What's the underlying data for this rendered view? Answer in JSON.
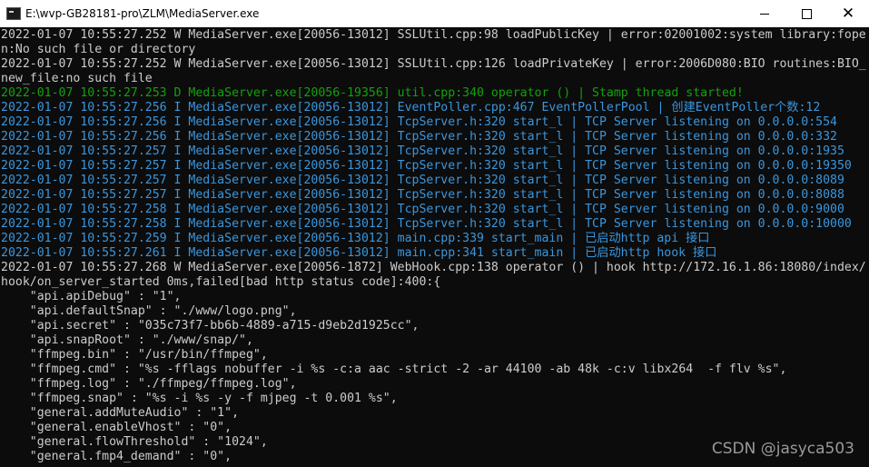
{
  "window": {
    "title": "E:\\wvp-GB28181-pro\\ZLM\\MediaServer.exe",
    "minimize_symbol": "",
    "close_symbol": "✕"
  },
  "console": {
    "lines": [
      {
        "text": "2022-01-07 10:55:27.252 W MediaServer.exe[20056-13012] SSLUtil.cpp:98 loadPublicKey | error:02001002:system library:fope",
        "color": "#cccccc"
      },
      {
        "text": "n:No such file or directory",
        "color": "#cccccc"
      },
      {
        "text": "2022-01-07 10:55:27.252 W MediaServer.exe[20056-13012] SSLUtil.cpp:126 loadPrivateKey | error:2006D080:BIO routines:BIO_",
        "color": "#cccccc"
      },
      {
        "text": "new_file:no such file",
        "color": "#cccccc"
      },
      {
        "text": "2022-01-07 10:55:27.253 D MediaServer.exe[20056-19356] util.cpp:340 operator () | Stamp thread started!",
        "color": "#13a10e"
      },
      {
        "text": "2022-01-07 10:55:27.256 I MediaServer.exe[20056-13012] EventPoller.cpp:467 EventPollerPool | 创建EventPoller个数:12",
        "color": "#3a96dd"
      },
      {
        "text": "2022-01-07 10:55:27.256 I MediaServer.exe[20056-13012] TcpServer.h:320 start_l | TCP Server listening on 0.0.0.0:554",
        "color": "#3a96dd"
      },
      {
        "text": "2022-01-07 10:55:27.256 I MediaServer.exe[20056-13012] TcpServer.h:320 start_l | TCP Server listening on 0.0.0.0:332",
        "color": "#3a96dd"
      },
      {
        "text": "2022-01-07 10:55:27.257 I MediaServer.exe[20056-13012] TcpServer.h:320 start_l | TCP Server listening on 0.0.0.0:1935",
        "color": "#3a96dd"
      },
      {
        "text": "2022-01-07 10:55:27.257 I MediaServer.exe[20056-13012] TcpServer.h:320 start_l | TCP Server listening on 0.0.0.0:19350",
        "color": "#3a96dd"
      },
      {
        "text": "2022-01-07 10:55:27.257 I MediaServer.exe[20056-13012] TcpServer.h:320 start_l | TCP Server listening on 0.0.0.0:8089",
        "color": "#3a96dd"
      },
      {
        "text": "2022-01-07 10:55:27.257 I MediaServer.exe[20056-13012] TcpServer.h:320 start_l | TCP Server listening on 0.0.0.0:8088",
        "color": "#3a96dd"
      },
      {
        "text": "2022-01-07 10:55:27.258 I MediaServer.exe[20056-13012] TcpServer.h:320 start_l | TCP Server listening on 0.0.0.0:9000",
        "color": "#3a96dd"
      },
      {
        "text": "2022-01-07 10:55:27.258 I MediaServer.exe[20056-13012] TcpServer.h:320 start_l | TCP Server listening on 0.0.0.0:10000",
        "color": "#3a96dd"
      },
      {
        "text": "2022-01-07 10:55:27.259 I MediaServer.exe[20056-13012] main.cpp:339 start_main | 已启动http api 接口",
        "color": "#3a96dd"
      },
      {
        "text": "2022-01-07 10:55:27.261 I MediaServer.exe[20056-13012] main.cpp:341 start_main | 已启动http hook 接口",
        "color": "#3a96dd"
      },
      {
        "text": "2022-01-07 10:55:27.268 W MediaServer.exe[20056-1872] WebHook.cpp:138 operator () | hook http://172.16.1.86:18080/index/",
        "color": "#cccccc"
      },
      {
        "text": "hook/on_server_started 0ms,failed[bad http status code]:400:{",
        "color": "#cccccc"
      },
      {
        "text": "    \"api.apiDebug\" : \"1\",",
        "color": "#cccccc"
      },
      {
        "text": "    \"api.defaultSnap\" : \"./www/logo.png\",",
        "color": "#cccccc"
      },
      {
        "text": "    \"api.secret\" : \"035c73f7-bb6b-4889-a715-d9eb2d1925cc\",",
        "color": "#cccccc"
      },
      {
        "text": "    \"api.snapRoot\" : \"./www/snap/\",",
        "color": "#cccccc"
      },
      {
        "text": "    \"ffmpeg.bin\" : \"/usr/bin/ffmpeg\",",
        "color": "#cccccc"
      },
      {
        "text": "    \"ffmpeg.cmd\" : \"%s -fflags nobuffer -i %s -c:a aac -strict -2 -ar 44100 -ab 48k -c:v libx264  -f flv %s\",",
        "color": "#cccccc"
      },
      {
        "text": "    \"ffmpeg.log\" : \"./ffmpeg/ffmpeg.log\",",
        "color": "#cccccc"
      },
      {
        "text": "    \"ffmpeg.snap\" : \"%s -i %s -y -f mjpeg -t 0.001 %s\",",
        "color": "#cccccc"
      },
      {
        "text": "    \"general.addMuteAudio\" : \"1\",",
        "color": "#cccccc"
      },
      {
        "text": "    \"general.enableVhost\" : \"0\",",
        "color": "#cccccc"
      },
      {
        "text": "    \"general.flowThreshold\" : \"1024\",",
        "color": "#cccccc"
      },
      {
        "text": "    \"general.fmp4_demand\" : \"0\",",
        "color": "#cccccc"
      }
    ]
  },
  "watermark": {
    "text": "CSDN @jasyca503"
  }
}
